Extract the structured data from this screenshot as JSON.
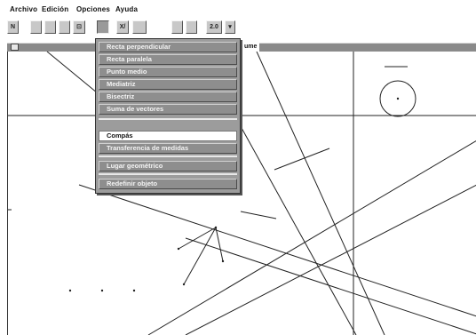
{
  "menubar": {
    "items": [
      {
        "label": "Archivo"
      },
      {
        "label": "Edición"
      },
      {
        "label": "Opciones"
      },
      {
        "label": "Ayuda"
      }
    ]
  },
  "toolbar": {
    "buttons": [
      {
        "icon": "pointer-icon",
        "label": "N"
      },
      {
        "icon": "point-icon",
        "label": ""
      },
      {
        "icon": "line-icon",
        "label": ""
      },
      {
        "icon": "circle-icon",
        "label": ""
      },
      {
        "icon": "construction-icon",
        "label": "⊡"
      },
      {
        "icon": "measure-icon",
        "label": ""
      },
      {
        "icon": "transform-icon",
        "label": "X/"
      },
      {
        "icon": "macro-icon",
        "label": ""
      },
      {
        "icon": "display-icon",
        "label": ""
      },
      {
        "icon": "numeric-icon",
        "label": "2.0"
      },
      {
        "icon": "arrow-down-icon",
        "label": "▾"
      }
    ]
  },
  "document": {
    "title": "ume"
  },
  "dropdown": {
    "items": [
      {
        "label": "Recta perpendicular",
        "selected": false
      },
      {
        "label": "Recta paralela",
        "selected": false
      },
      {
        "label": "Punto medio",
        "selected": false
      },
      {
        "label": "Mediatriz",
        "selected": false
      },
      {
        "label": "Bisectriz",
        "selected": false
      },
      {
        "label": "Suma de vectores",
        "selected": false
      },
      {
        "label": "Compás",
        "selected": true
      },
      {
        "label": "Transferencia de medidas",
        "selected": false
      },
      {
        "label": "Lugar geométrico",
        "selected": false
      },
      {
        "label": "Redefinir objeto",
        "selected": false
      }
    ]
  },
  "colors": {
    "menu_bg": "#9c9c9c",
    "menu_item": "#8e8e8e",
    "titlebar": "#8a8a8a",
    "drawing": "#222222"
  }
}
